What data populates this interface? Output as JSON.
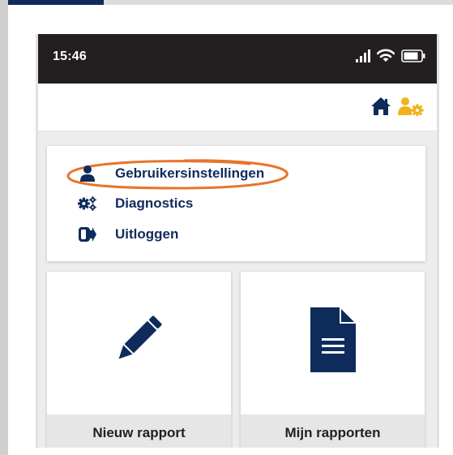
{
  "status_bar": {
    "time": "15:46",
    "icons": [
      "signal-icon",
      "wifi-icon",
      "battery-icon"
    ]
  },
  "header": {
    "icons": [
      "home-icon",
      "user-settings-icon"
    ]
  },
  "menu": {
    "items": [
      {
        "label": "Gebruikersinstellingen",
        "icon": "user-icon",
        "highlighted": true
      },
      {
        "label": "Diagnostics",
        "icon": "gears-icon"
      },
      {
        "label": "Uitloggen",
        "icon": "logout-icon"
      }
    ]
  },
  "tiles": [
    {
      "label": "Nieuw rapport",
      "icon": "pencil-icon"
    },
    {
      "label": "Mijn rapporten",
      "icon": "document-icon"
    }
  ],
  "colors": {
    "brand_navy": "#0f2b5b",
    "accent_yellow": "#f2b21b",
    "highlight_orange": "#e8742a",
    "status_bar": "#231f20"
  }
}
